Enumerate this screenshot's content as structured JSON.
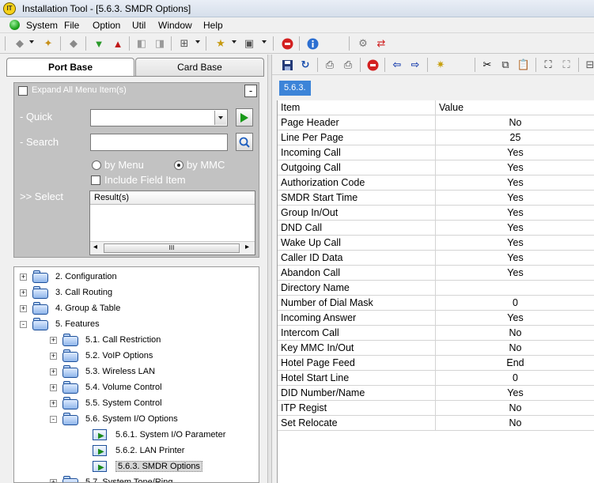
{
  "window": {
    "title": "Installation Tool - [5.6.3. SMDR Options]"
  },
  "menu": [
    "System",
    "File",
    "Option",
    "Util",
    "Window",
    "Help"
  ],
  "left": {
    "tabs": [
      "Port Base",
      "Card Base"
    ],
    "expand_all_label": "Expand All Menu Item(s)",
    "collapse_symbol": "-",
    "quick_label": "- Quick",
    "search_label": "- Search",
    "by_menu_label": "by Menu",
    "by_mmc_label": "by MMC",
    "include_field_label": "Include Field Item",
    "select_label": ">> Select",
    "results_header": "Result(s)",
    "scroll_thumb_glyph": "III",
    "tree": [
      {
        "label": "2. Configuration",
        "level": 0,
        "expander": "+",
        "icon": "folder-icon"
      },
      {
        "label": "3. Call Routing",
        "level": 0,
        "expander": "+",
        "icon": "folder-icon"
      },
      {
        "label": "4. Group & Table",
        "level": 0,
        "expander": "+",
        "icon": "folder-icon"
      },
      {
        "label": "5. Features",
        "level": 0,
        "expander": "-",
        "icon": "folder-open-icon"
      },
      {
        "label": "5.1. Call Restriction",
        "level": 1,
        "expander": "+",
        "icon": "folder-icon"
      },
      {
        "label": "5.2. VoIP Options",
        "level": 1,
        "expander": "+",
        "icon": "folder-icon"
      },
      {
        "label": "5.3. Wireless LAN",
        "level": 1,
        "expander": "+",
        "icon": "folder-icon"
      },
      {
        "label": "5.4. Volume Control",
        "level": 1,
        "expander": "+",
        "icon": "folder-icon"
      },
      {
        "label": "5.5. System Control",
        "level": 1,
        "expander": "+",
        "icon": "folder-icon"
      },
      {
        "label": "5.6. System I/O Options",
        "level": 1,
        "expander": "-",
        "icon": "folder-open-icon"
      },
      {
        "label": "5.6.1. System I/O Parameter",
        "level": 2,
        "expander": "",
        "icon": "page-icon"
      },
      {
        "label": "5.6.2. LAN Printer",
        "level": 2,
        "expander": "",
        "icon": "page-icon"
      },
      {
        "label": "5.6.3. SMDR Options",
        "level": 2,
        "expander": "",
        "icon": "page-icon",
        "selected": true
      },
      {
        "label": "5.7. System Tone/Ring",
        "level": 1,
        "expander": "+",
        "icon": "folder-icon"
      }
    ]
  },
  "right": {
    "path_badge": "5.6.3.",
    "columns": [
      "Item",
      "Value"
    ],
    "rows": [
      [
        "Page Header",
        "No"
      ],
      [
        "Line Per Page",
        "25"
      ],
      [
        "Incoming Call",
        "Yes"
      ],
      [
        "Outgoing Call",
        "Yes"
      ],
      [
        "Authorization Code",
        "Yes"
      ],
      [
        "SMDR Start Time",
        "Yes"
      ],
      [
        "Group In/Out",
        "Yes"
      ],
      [
        "DND Call",
        "Yes"
      ],
      [
        "Wake Up Call",
        "Yes"
      ],
      [
        "Caller ID Data",
        "Yes"
      ],
      [
        "Abandon Call",
        "Yes"
      ],
      [
        "Directory Name",
        ""
      ],
      [
        "Number of Dial Mask",
        "0"
      ],
      [
        "Incoming Answer",
        "Yes"
      ],
      [
        "Intercom Call",
        "No"
      ],
      [
        "Key MMC In/Out",
        "No"
      ],
      [
        "Hotel Page Feed",
        "End"
      ],
      [
        "Hotel Start Line",
        "0"
      ],
      [
        "DID Number/Name",
        "Yes"
      ],
      [
        "ITP Regist",
        "No"
      ],
      [
        "Set Relocate",
        "No"
      ]
    ]
  },
  "colors": {
    "badge": "#3c84d8",
    "panel_gray": "#c2c2c2"
  }
}
